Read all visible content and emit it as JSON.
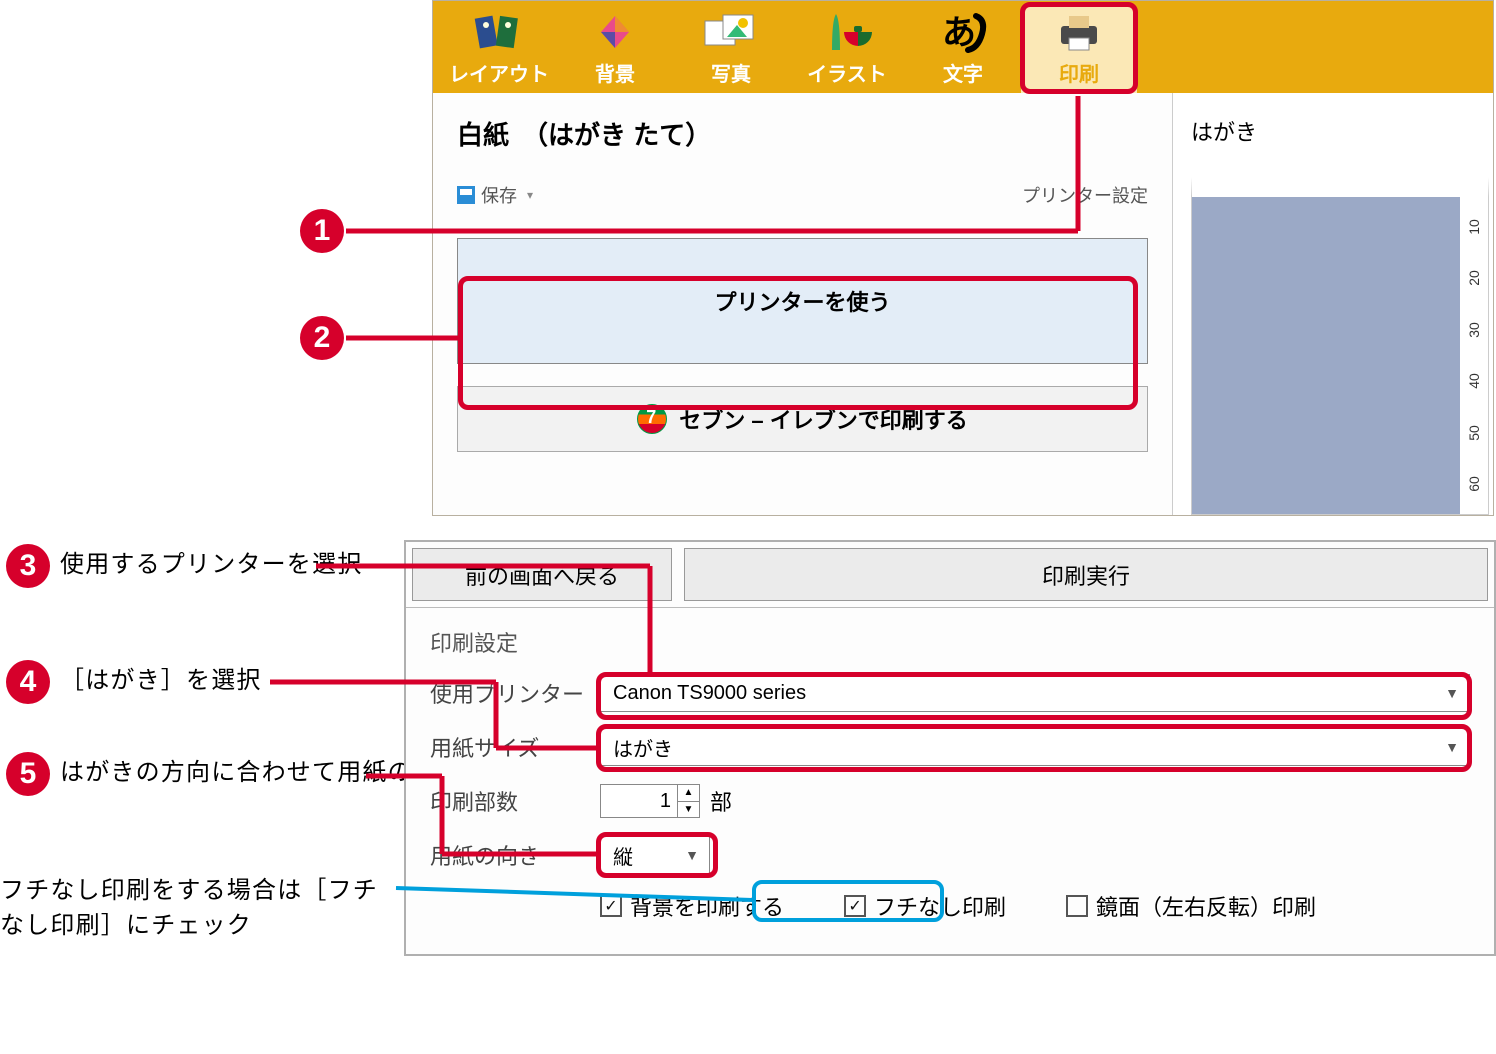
{
  "callouts": {
    "c1": "",
    "c2": "",
    "c3": "使用するプリンターを選択",
    "c4": "［はがき］を選択",
    "c5": "はがきの方向に合わせて用紙の向きを選択",
    "borderless": "フチなし印刷をする場合は［フチなし印刷］にチェック"
  },
  "toolbar": {
    "tabs": {
      "layout": "レイアウト",
      "background": "背景",
      "photo": "写真",
      "illust": "イラスト",
      "text": "文字",
      "print": "印刷"
    }
  },
  "panel1": {
    "title": "白紙　（はがき たて）",
    "save": "保存",
    "save_menu_caret": "▾",
    "printer_settings": "プリンター設定",
    "use_printer": "プリンターを使う",
    "seven": "セブン – イレブンで印刷する",
    "preview_label": "はがき",
    "ruler": [
      "10",
      "20",
      "30",
      "40",
      "50",
      "60"
    ]
  },
  "panel2": {
    "back": "前の画面へ戻る",
    "exec": "印刷実行",
    "section": "印刷設定",
    "labels": {
      "printer": "使用プリンター",
      "paper": "用紙サイズ",
      "copies": "印刷部数",
      "orient": "用紙の向き"
    },
    "values": {
      "printer": "Canon TS9000 series",
      "paper": "はがき",
      "copies": "1",
      "copies_unit": "部",
      "orient": "縦"
    },
    "checks": {
      "bg": "背景を印刷する",
      "borderless": "フチなし印刷",
      "mirror": "鏡面（左右反転）印刷"
    }
  }
}
